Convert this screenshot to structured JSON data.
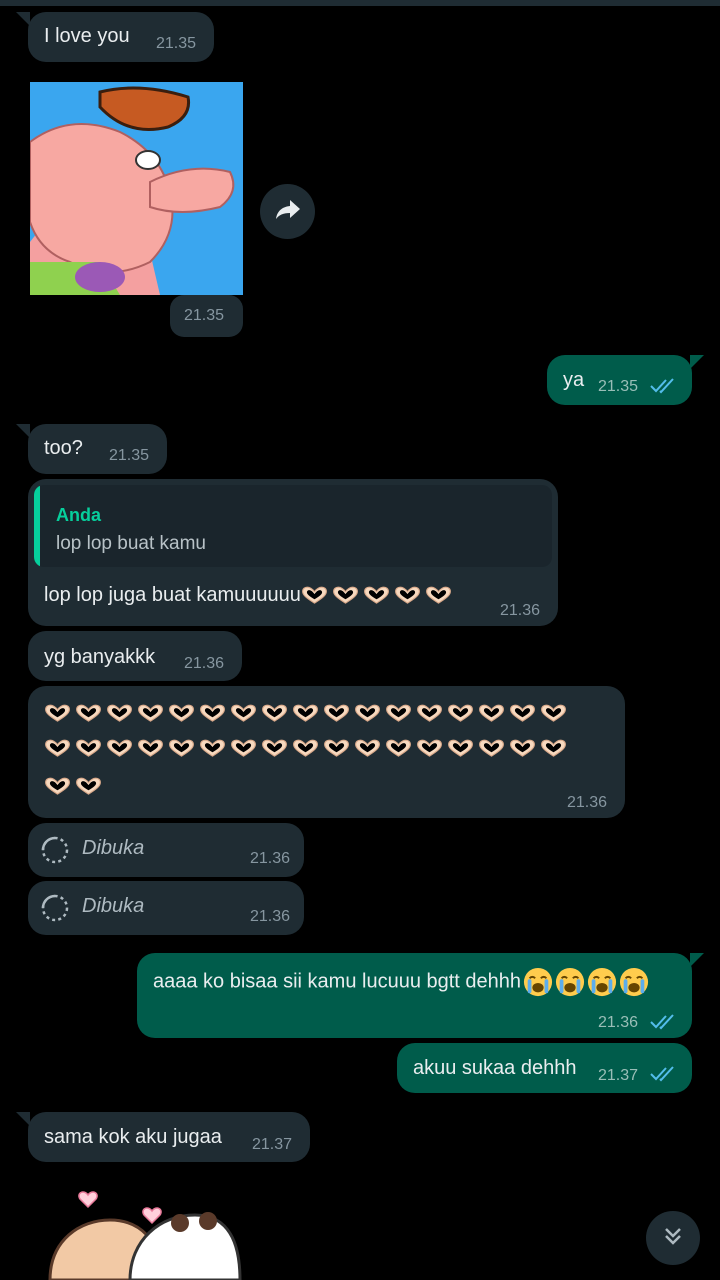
{
  "messages": {
    "m1": {
      "text": "I love you",
      "time": "21.35"
    },
    "sticker_time": "21.35",
    "m2": {
      "text": "ya",
      "time": "21.35"
    },
    "m3": {
      "text": "too?",
      "time": "21.35"
    },
    "m4": {
      "quote_author": "Anda",
      "quote_text": "lop lop buat kamu",
      "text": "lop lop juga buat kamuuuuuu",
      "heart_count": 5,
      "time": "21.36"
    },
    "m5": {
      "text": "yg banyakkk",
      "time": "21.36"
    },
    "m6": {
      "heart_rows": [
        17,
        17,
        2
      ],
      "time": "21.36"
    },
    "m7": {
      "text": "Dibuka",
      "time": "21.36"
    },
    "m8": {
      "text": "Dibuka",
      "time": "21.36"
    },
    "m9": {
      "text": "aaaa ko bisaa sii kamu lucuuu bgtt dehhh",
      "crying_emoji_count": 4,
      "time": "21.36"
    },
    "m10": {
      "text": "akuu sukaa dehhh",
      "time": "21.37"
    },
    "m11": {
      "text": "sama kok aku jugaa",
      "time": "21.37"
    }
  },
  "icons": {
    "forward": "forward-arrow-icon",
    "view_once": "view-once-icon",
    "read_ticks": "double-check-icon",
    "scroll": "double-chevron-down-icon"
  },
  "colors": {
    "incoming_bubble": "#1f2c33",
    "outgoing_bubble": "#005c4b",
    "read_ticks": "#53bdeb",
    "quote_accent": "#06cf9c"
  }
}
